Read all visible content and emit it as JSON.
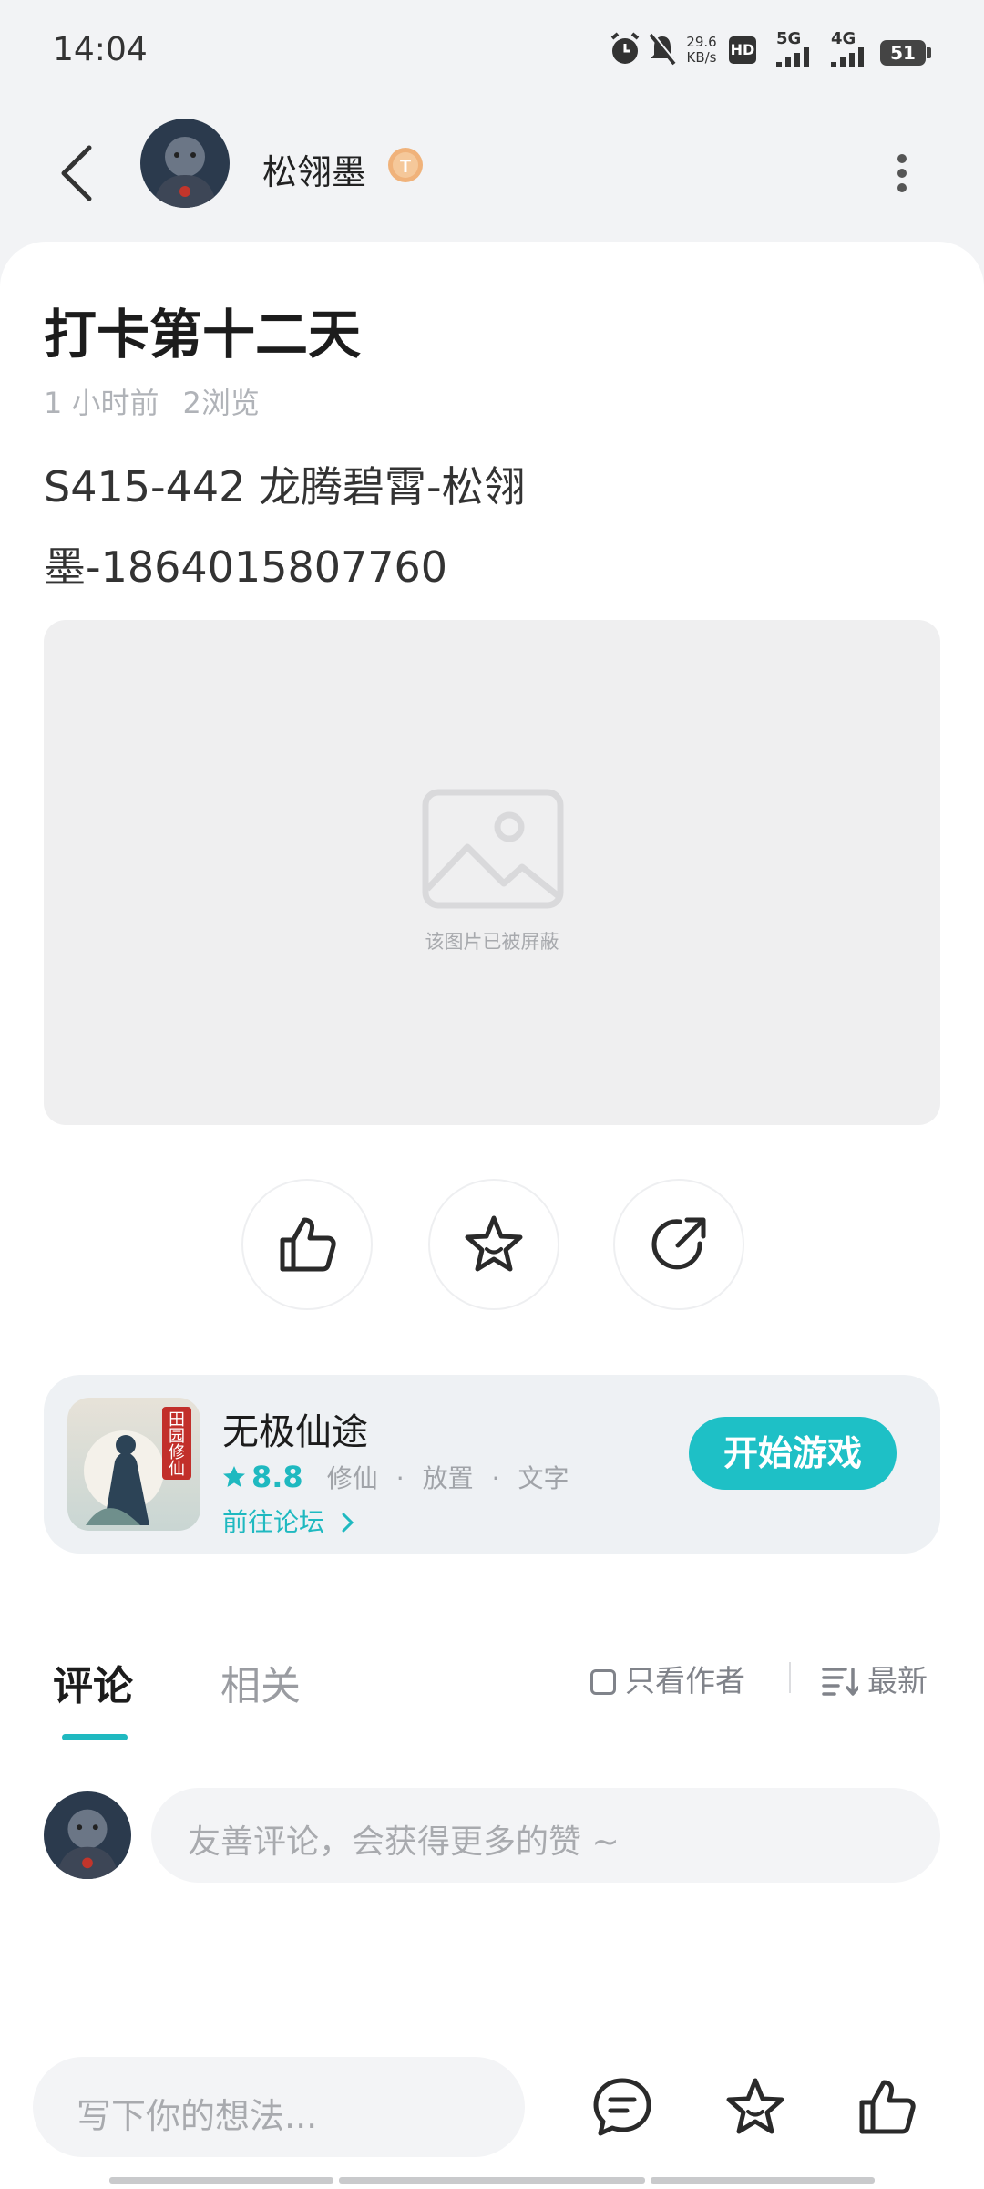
{
  "status_bar": {
    "time": "14:04",
    "net_speed_value": "29.6",
    "net_speed_unit": "KB/s",
    "hd_label": "HD",
    "signal_5g": "5G",
    "signal_4g": "4G",
    "battery": "51"
  },
  "header": {
    "username": "松翎墨",
    "level_badge": "T"
  },
  "post": {
    "title": "打卡第十二天",
    "time_ago": "1 小时前",
    "views": "2浏览",
    "body_line1": "S415-442 龙腾碧霄-松翎",
    "body_line2": "墨-1864015807760",
    "media_blocked_text": "该图片已被屏蔽"
  },
  "game": {
    "icon_text": "田园修仙",
    "name": "无极仙途",
    "rating": "8.8",
    "tags": [
      "修仙",
      "放置",
      "文字"
    ],
    "forum_link": "前往论坛",
    "play_button": "开始游戏"
  },
  "comments": {
    "tab_comments": "评论",
    "tab_related": "相关",
    "author_only": "只看作者",
    "sort": "最新",
    "input_placeholder": "友善评论，会获得更多的赞 ~"
  },
  "bottom_bar": {
    "input_placeholder": "写下你的想法..."
  },
  "colors": {
    "accent": "#1fb9c0",
    "play_button": "#1ec0c6",
    "badge": "#f0b27a"
  },
  "icons": [
    "back-arrow-icon",
    "more-vertical-icon",
    "thumbs-up-icon",
    "star-icon",
    "share-icon",
    "image-placeholder-icon",
    "chevron-right-icon",
    "comment-icon",
    "sort-icon"
  ]
}
